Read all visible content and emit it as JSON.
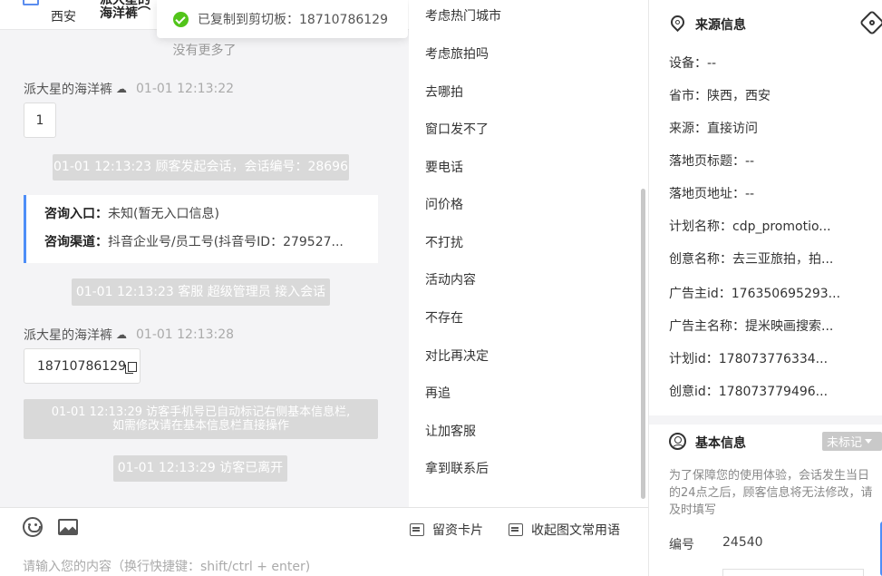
{
  "chat": {
    "top_city": "西安",
    "top_name": "派大星的海洋裤⌒",
    "toast": "已复制到剪切板：18710786129",
    "no_more": "没有更多了",
    "msg1_sender": "派大星的海洋裤",
    "msg1_time": "01-01 12:13:22",
    "msg1_text": "1",
    "sys1": "01-01 12:13:23 顾客发起会话，会话编号：28696",
    "card_entry_label": "咨询入口：",
    "card_entry_value": "未知(暂无入口信息)",
    "card_channel_label": "咨询渠道：",
    "card_channel_value": "抖音企业号/员工号(抖音号ID：279527...",
    "sys2": "01-01 12:13:23 客服 超级管理员 接入会话",
    "msg2_sender": "派大星的海洋裤",
    "msg2_time": "01-01 12:13:28",
    "msg2_text": "18710786129",
    "sys3_line1": "01-01 12:13:29 访客手机号已自动标记右侧基本信息栏,",
    "sys3_line2": "如需修改请在基本信息栏直接操作",
    "sys4": "01-01 12:13:29 访客已离开"
  },
  "input": {
    "card_btn": "留资卡片",
    "phrases_btn": "收起图文常用语",
    "placeholder": "请输入您的内容（换行快捷键：shift/ctrl + enter)"
  },
  "phrases": [
    "考虑热门城市",
    "考虑旅拍吗",
    "去哪拍",
    "窗口发不了",
    "要电话",
    "问价格",
    "不打扰",
    "活动内容",
    "不存在",
    "对比再决定",
    "再追",
    "让加客服",
    "拿到联系后"
  ],
  "source": {
    "title": "来源信息",
    "device": "设备：--",
    "province": "省市：陕西，西安",
    "origin": "来源：直接访问",
    "landing_title": "落地页标题：--",
    "landing_url": "落地页地址：--",
    "plan_name": "计划名称：cdp_promotio...",
    "creative_name": "创意名称：去三亚旅拍，拍...",
    "advertiser_id": "广告主id：176350695293...",
    "advertiser_name": "广告主名称：提米映画搜索...",
    "plan_id": "计划id：178073776334...",
    "creative_id": "创意id：178073779496..."
  },
  "basic": {
    "title": "基本信息",
    "tag": "未标记",
    "notice": "为了保障您的使用体验，会话发生当日的24点之后，顾客信息将无法修改，请及时填写",
    "number_label": "编号",
    "number_value": "24540"
  },
  "colors": {
    "accent": "#4e8ef7",
    "success": "#52c41a",
    "system_bubble": "#d9d9d9"
  }
}
